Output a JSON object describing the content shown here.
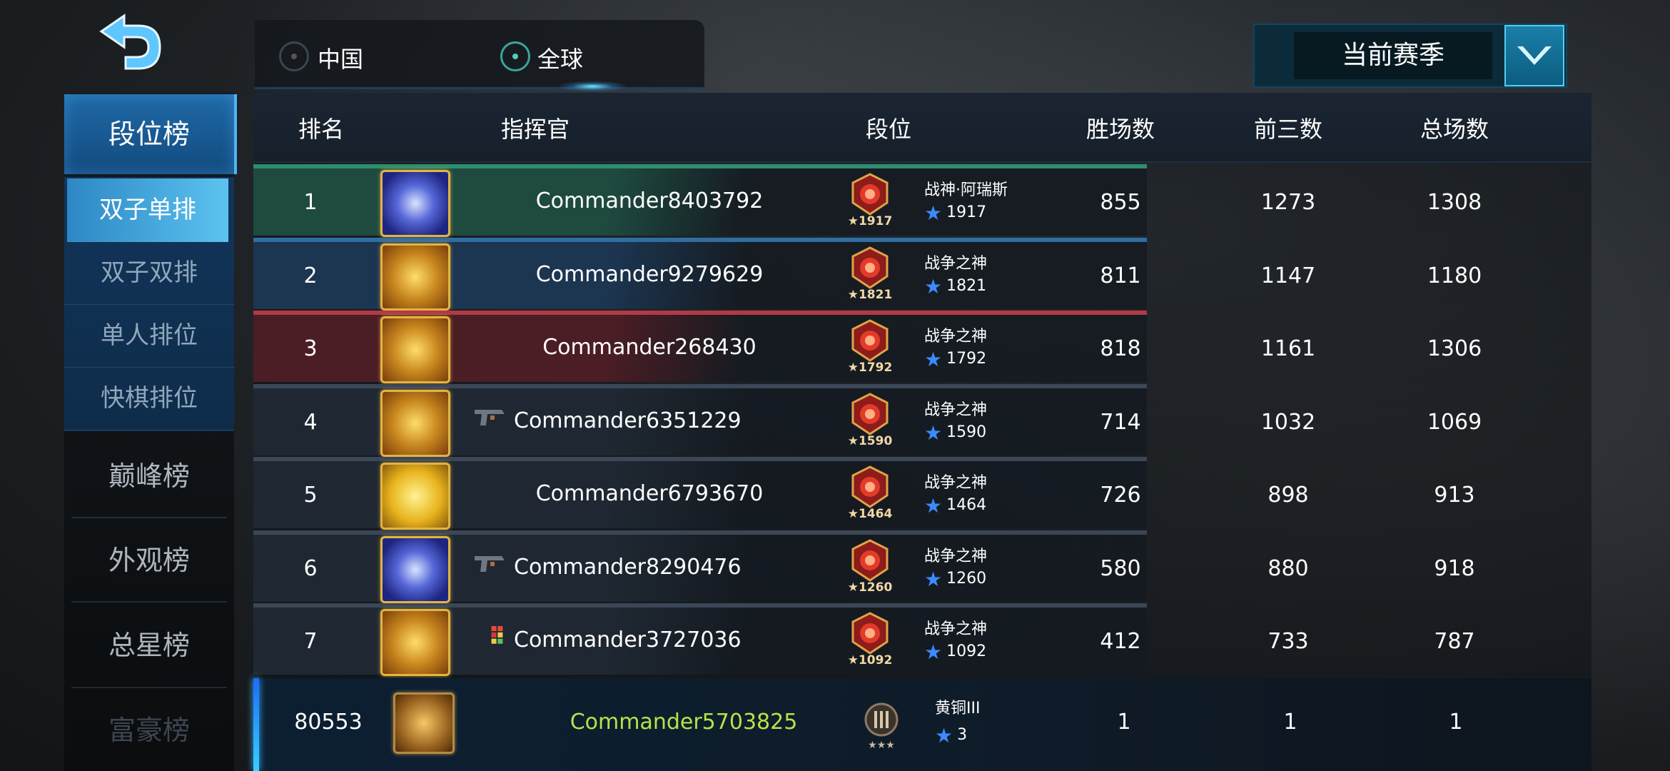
{
  "header": {
    "region_options": [
      {
        "label": "中国",
        "selected": false
      },
      {
        "label": "全球",
        "selected": true
      }
    ],
    "season_label": "当前赛季"
  },
  "sidebar": {
    "main_tabs": [
      "段位榜",
      "巅峰榜",
      "外观榜",
      "总星榜",
      "富豪榜"
    ],
    "sub_tabs": [
      "双子单排",
      "双子双排",
      "单人排位",
      "快棋排位"
    ],
    "active_main": "段位榜",
    "active_sub": "双子单排"
  },
  "table": {
    "columns": [
      "排名",
      "指挥官",
      "段位",
      "胜场数",
      "前三数",
      "总场数"
    ],
    "rows": [
      {
        "rank": "1",
        "commander": "Commander8403792",
        "avatar": "blue-crest-icon",
        "tier": "战神·阿瑞斯",
        "stars": "1917",
        "badge": "1917",
        "wins": "855",
        "top3": "1273",
        "total": "1308",
        "bar_color": "#2e8d6d",
        "row_color": "#1e4a40"
      },
      {
        "rank": "2",
        "commander": "Commander9279629",
        "avatar": "golden-beast-icon",
        "tier": "战争之神",
        "stars": "1821",
        "badge": "1821",
        "wins": "811",
        "top3": "1147",
        "total": "1180",
        "bar_color": "#2f6ea2",
        "row_color": "#1c3550"
      },
      {
        "rank": "3",
        "commander": "Commander268430",
        "avatar": "golden-beast-icon",
        "tier": "战争之神",
        "stars": "1792",
        "badge": "1792",
        "wins": "818",
        "top3": "1161",
        "total": "1306",
        "bar_color": "#b23a44",
        "row_color": "#4b1d24"
      },
      {
        "rank": "4",
        "commander": "Commander6351229",
        "avatar": "golden-beast-icon",
        "tier": "战争之神",
        "stars": "1590",
        "badge": "1590",
        "wins": "714",
        "top3": "1032",
        "total": "1069",
        "bar_color": "#3b4757",
        "row_color": "#1f2832",
        "prefix_icon": "pistol-icon"
      },
      {
        "rank": "5",
        "commander": "Commander6793670",
        "avatar": "golden-dragon-icon",
        "tier": "战争之神",
        "stars": "1464",
        "badge": "1464",
        "wins": "726",
        "top3": "898",
        "total": "913",
        "bar_color": "#3b4757",
        "row_color": "#1f2832"
      },
      {
        "rank": "6",
        "commander": "Commander8290476",
        "avatar": "blue-crest-icon",
        "tier": "战争之神",
        "stars": "1260",
        "badge": "1260",
        "wins": "580",
        "top3": "880",
        "total": "918",
        "bar_color": "#3b4757",
        "row_color": "#1f2832",
        "prefix_icon": "pistol-icon"
      },
      {
        "rank": "7",
        "commander": "Commander3727036",
        "avatar": "golden-beast-icon",
        "tier": "战争之神",
        "stars": "1092",
        "badge": "1092",
        "wins": "412",
        "top3": "733",
        "total": "787",
        "bar_color": "#3b4757",
        "row_color": "#1f2832",
        "prefix_icon": "blocks-icon"
      }
    ]
  },
  "my_row": {
    "rank": "80553",
    "commander": "Commander5703825",
    "avatar": "bronze-emblem-icon",
    "tier": "黄铜III",
    "stars": "3",
    "wins": "1",
    "top3": "1",
    "total": "1",
    "name_color": "#b5e34a"
  }
}
